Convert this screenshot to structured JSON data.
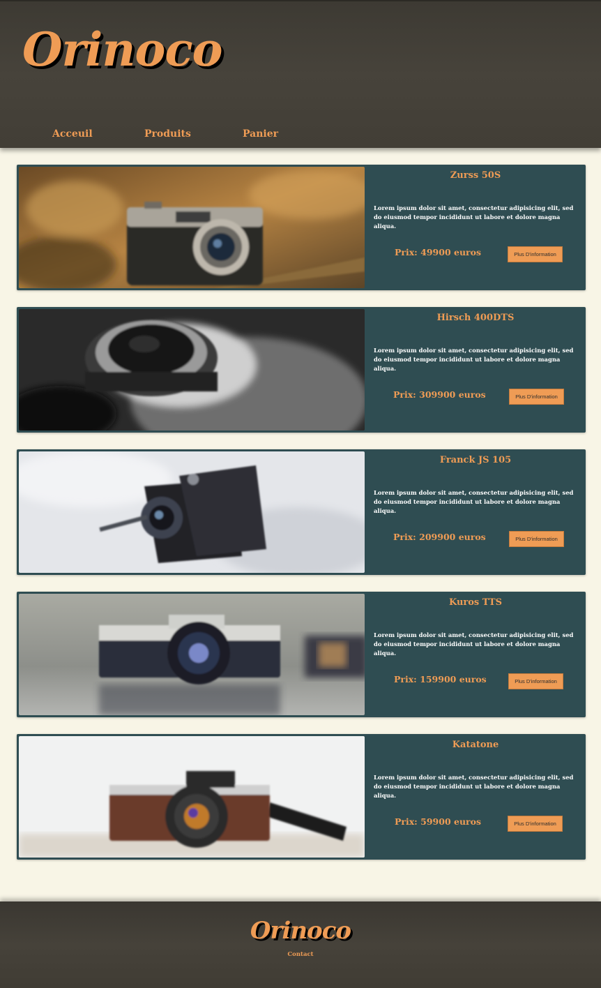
{
  "header": {
    "logo": "Orinoco",
    "nav": [
      "Acceuil",
      "Produits",
      "Panier"
    ]
  },
  "products": [
    {
      "name": "Zurss 50S",
      "description": "Lorem ipsum dolor sit amet, consectetur adipisicing elit, sed do eiusmod tempor incididunt ut labore et dolore magna aliqua.",
      "price": "Prix: 49900 euros",
      "button": "Plus D'information",
      "image": "vintage-rangefinder-camera-photo"
    },
    {
      "name": "Hirsch 400DTS",
      "description": "Lorem ipsum dolor sit amet, consectetur adipisicing elit, sed do eiusmod tempor incididunt ut labore et dolore magna aliqua.",
      "price": "Prix: 309900 euros",
      "button": "Plus D'information",
      "image": "black-and-white-camera-lens-photo"
    },
    {
      "name": "Franck JS 105",
      "description": "Lorem ipsum dolor sit amet, consectetur adipisicing elit, sed do eiusmod tempor incididunt ut labore et dolore magna aliqua.",
      "price": "Prix: 209900 euros",
      "button": "Plus D'information",
      "image": "folding-bellows-camera-photo"
    },
    {
      "name": "Kuros TTS",
      "description": "Lorem ipsum dolor sit amet, consectetur adipisicing elit, sed do eiusmod tempor incididunt ut labore et dolore magna aliqua.",
      "price": "Prix: 159900 euros",
      "button": "Plus D'information",
      "image": "minolta-slr-camera-photo"
    },
    {
      "name": "Katatone",
      "description": "Lorem ipsum dolor sit amet, consectetur adipisicing elit, sed do eiusmod tempor incididunt ut labore et dolore magna aliqua.",
      "price": "Prix: 59900 euros",
      "button": "Plus D'information",
      "image": "brown-leather-camera-photo"
    }
  ],
  "footer": {
    "logo": "Orinoco",
    "link": "Contact"
  },
  "colors": {
    "accent": "#ef9c55",
    "card_bg": "#2f4d52",
    "page_bg": "#f8f5e6",
    "header_bg": "#45413a"
  }
}
